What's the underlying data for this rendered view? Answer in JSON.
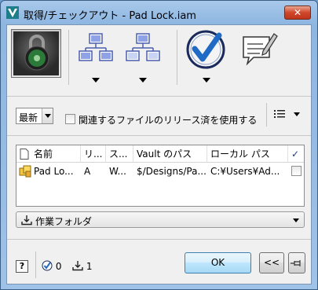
{
  "window": {
    "title": "取得/チェックアウト - Pad Lock.iam",
    "close_label": "✕"
  },
  "toolbar": {
    "items": [
      {
        "name": "lock-part-thumbnail"
      },
      {
        "name": "include-children",
        "icon": "parent-children-tree-icon"
      },
      {
        "name": "include-parents",
        "icon": "parent-tree-icon"
      },
      {
        "name": "check-out",
        "icon": "checkmark-circle-icon"
      },
      {
        "name": "comment",
        "icon": "speech-bubble-pencil-icon"
      }
    ]
  },
  "options": {
    "revision_select_value": "最新",
    "use_released_label": "関連するファイルのリリース済を使用する",
    "use_released_checked": false
  },
  "table": {
    "columns": [
      "名前",
      "リ...",
      "ス...",
      "Vault のパス",
      "ローカル パス",
      "✓"
    ],
    "rows": [
      {
        "name": "Pad Lo...",
        "revision": "A",
        "state": "W...",
        "vault_path": "$/Designs/Pa...",
        "local_path": "C:¥Users¥Ad...",
        "checked": false
      }
    ]
  },
  "folder_dropdown": {
    "value": "作業フォルダ"
  },
  "footer": {
    "help_label": "?",
    "checkout_count": "0",
    "download_count": "1",
    "ok_label": "OK",
    "collapse_label": "<<"
  },
  "colors": {
    "accent": "#1f6ac4",
    "title_bar": "#9fc2e8",
    "close_button": "#c9442b"
  }
}
